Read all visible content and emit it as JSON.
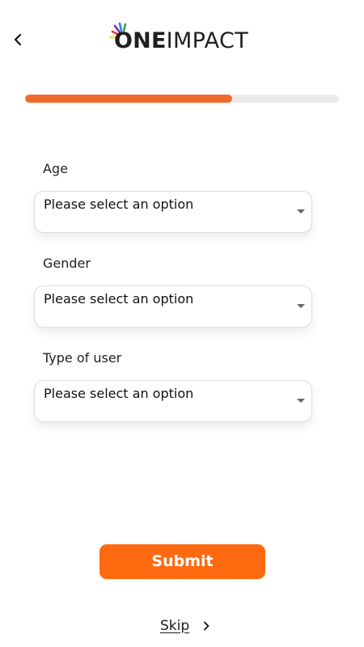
{
  "header": {
    "logo_one": "ONE",
    "logo_impact": "IMPACT"
  },
  "progress": {
    "value": 0.66
  },
  "form": {
    "fields": [
      {
        "label": "Age",
        "value": "Please select an option"
      },
      {
        "label": "Gender",
        "value": "Please select an option"
      },
      {
        "label": "Type of user",
        "value": "Please select an option"
      }
    ]
  },
  "actions": {
    "submit_label": "Submit",
    "skip_label": "Skip"
  },
  "colors": {
    "brand_orange": "#ff6a10",
    "progress_orange": "#f06a2c",
    "track_gray": "#ebebeb"
  },
  "icons": {
    "back": "chevron-left-icon",
    "skip": "chevron-right-icon",
    "dropdown": "caret-down-icon"
  }
}
